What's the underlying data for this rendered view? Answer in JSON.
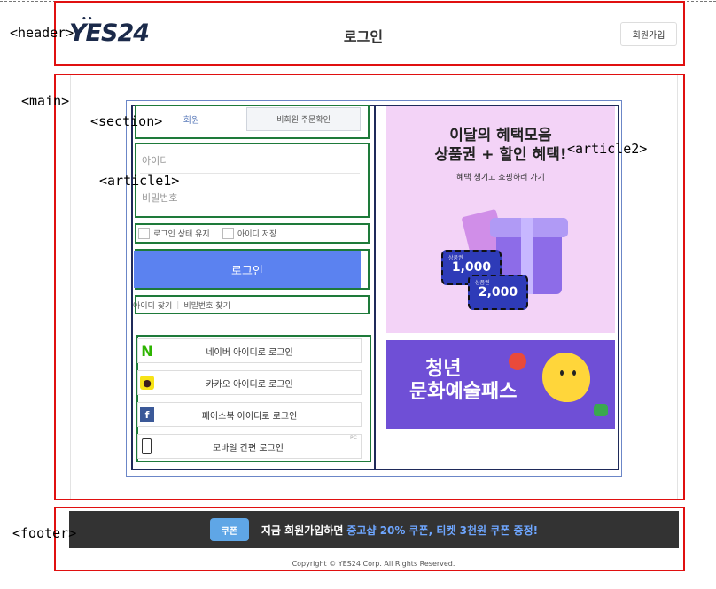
{
  "annotations": {
    "header": "<header>",
    "main": "<main>",
    "section": "<section>",
    "article1": "<article1>",
    "article2": "<article2>",
    "footer": "<footer>"
  },
  "header": {
    "logo": "YES24",
    "title": "로그인",
    "signup_label": "회원가입"
  },
  "tabs": {
    "member": "회원",
    "guest": "비회원 주문확인"
  },
  "form": {
    "id_placeholder": "아이디",
    "pw_placeholder": "비밀번호",
    "keep_login": "로그인 상태 유지",
    "save_id": "아이디 저장",
    "login_button": "로그인",
    "find_id": "아이디 찾기",
    "find_pw": "비밀번호 찾기"
  },
  "social": {
    "naver": "네이버 아이디로 로그인",
    "kakao": "카카오 아이디로 로그인",
    "facebook": "페이스북 아이디로 로그인",
    "mobile": "모바일 간편 로그인",
    "badge": "PC"
  },
  "banner1": {
    "title_line1": "이달의 혜택모음",
    "title_line2": "상품권 + 할인 혜택!",
    "subtitle": "혜택 챙기고 쇼핑하러 가기",
    "coupon1_value": "1,000",
    "coupon2_value": "2,000",
    "coupon_tag": "상품권"
  },
  "banner2": {
    "title_line1": "청년",
    "title_line2": "문화예술패스"
  },
  "footer": {
    "coupon_icon": "쿠폰",
    "promo_prefix": "지금 회원가입하면",
    "promo_highlight": "중고샵 20% 쿠폰, 티켓 3천원 쿠폰 증정!",
    "copyright": "Copyright © YES24 Corp. All Rights Reserved."
  },
  "colors": {
    "login_button": "#5b82f0",
    "footer_bar": "#333333",
    "outline_red": "#e01010",
    "outline_green": "#1e7a3a"
  }
}
